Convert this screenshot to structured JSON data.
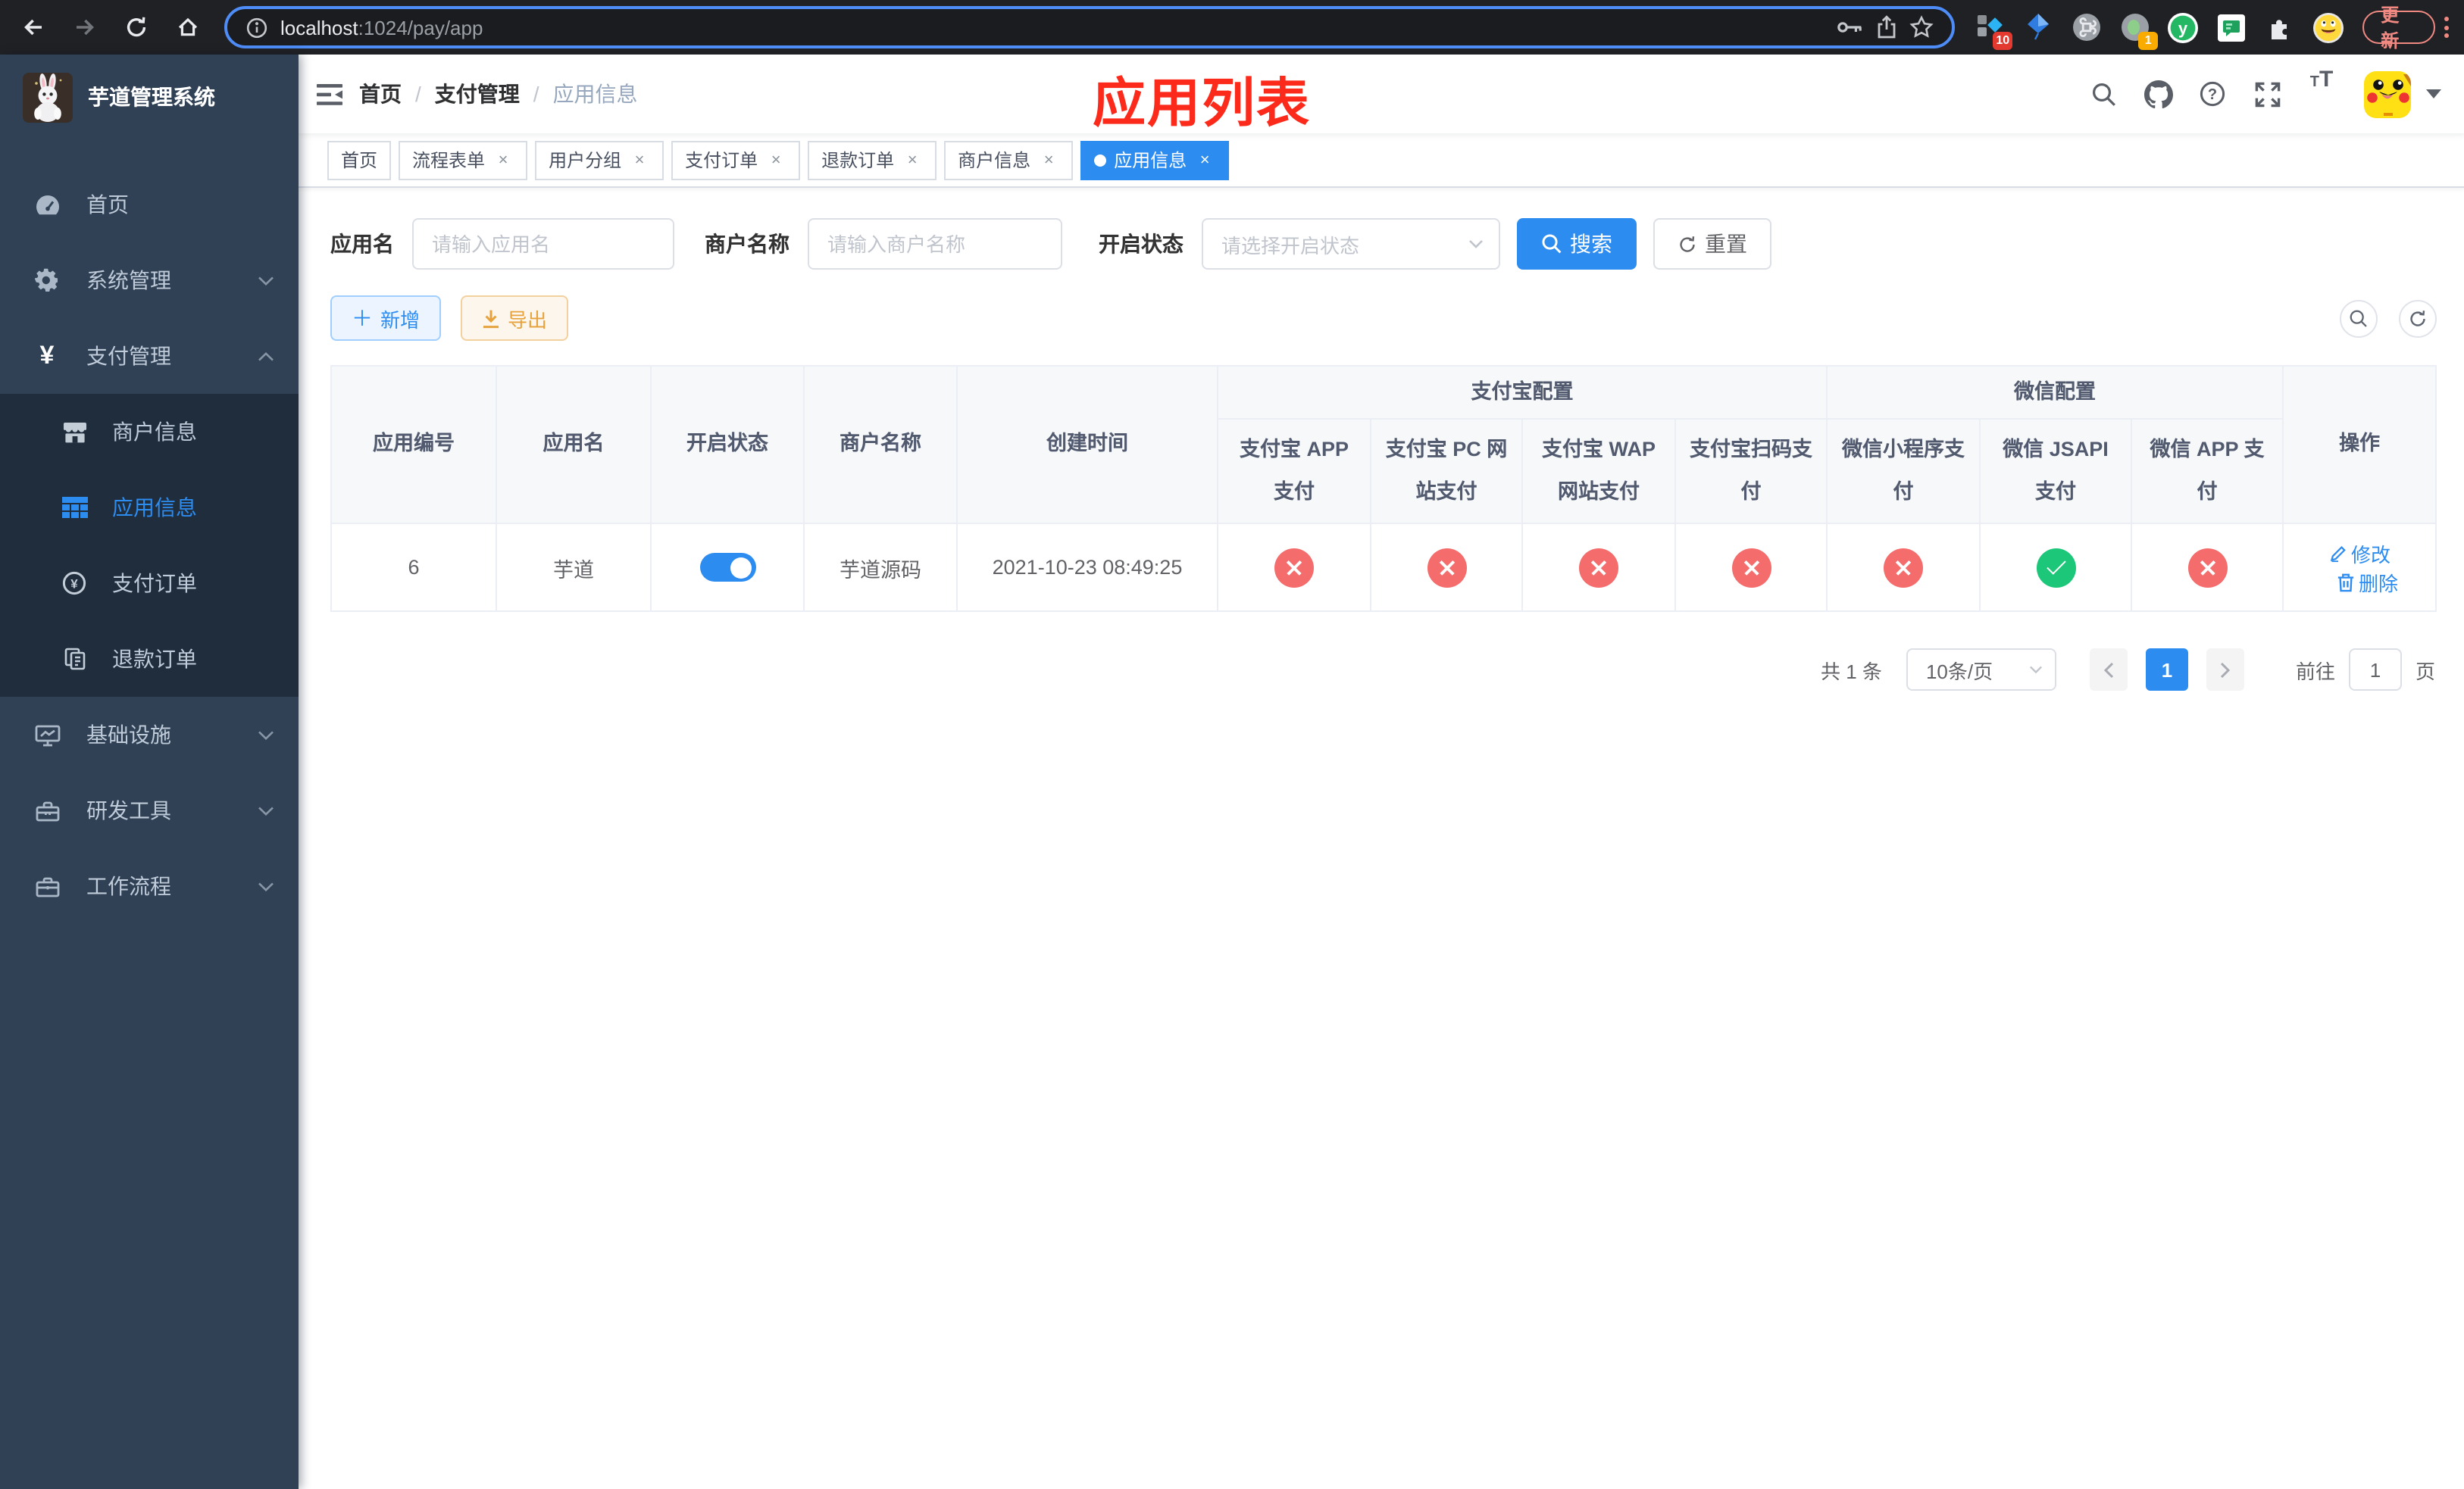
{
  "browser": {
    "url_host": "localhost",
    "url_path": ":1024/pay/app",
    "update_label": "更新",
    "ext_badge_count": "10",
    "tab_badge_count": "1"
  },
  "sidebar": {
    "title": "芋道管理系统",
    "menu": [
      {
        "label": "首页"
      },
      {
        "label": "系统管理"
      },
      {
        "label": "支付管理"
      },
      {
        "label": "基础设施"
      },
      {
        "label": "研发工具"
      },
      {
        "label": "工作流程"
      }
    ],
    "submenu": [
      {
        "label": "商户信息"
      },
      {
        "label": "应用信息"
      },
      {
        "label": "支付订单"
      },
      {
        "label": "退款订单"
      }
    ]
  },
  "header": {
    "breadcrumb": {
      "home": "首页",
      "section": "支付管理",
      "current": "应用信息"
    },
    "annotation": "应用列表"
  },
  "tabs": [
    {
      "label": "首页"
    },
    {
      "label": "流程表单"
    },
    {
      "label": "用户分组"
    },
    {
      "label": "支付订单"
    },
    {
      "label": "退款订单"
    },
    {
      "label": "商户信息"
    },
    {
      "label": "应用信息"
    }
  ],
  "filters": {
    "app_name_label": "应用名",
    "app_name_placeholder": "请输入应用名",
    "merchant_label": "商户名称",
    "merchant_placeholder": "请输入商户名称",
    "status_label": "开启状态",
    "status_placeholder": "请选择开启状态",
    "search_label": "搜索",
    "reset_label": "重置"
  },
  "toolbar": {
    "add_label": "新增",
    "export_label": "导出"
  },
  "table": {
    "columns": [
      "应用编号",
      "应用名",
      "开启状态",
      "商户名称",
      "创建时间"
    ],
    "groups": {
      "alipay": "支付宝配置",
      "wechat": "微信配置",
      "actions": "操作"
    },
    "subcolumns": [
      "支付宝 APP 支付",
      "支付宝 PC 网站支付",
      "支付宝 WAP 网站支付",
      "支付宝扫码支付",
      "微信小程序支付",
      "微信 JSAPI 支付",
      "微信 APP 支付"
    ],
    "row": {
      "id": "6",
      "name": "芋道",
      "enabled": true,
      "merchant": "芋道源码",
      "created": "2021-10-23 08:49:25",
      "statuses": [
        "fail",
        "fail",
        "fail",
        "fail",
        "fail",
        "success",
        "fail"
      ],
      "edit_label": "修改",
      "delete_label": "删除"
    }
  },
  "pagination": {
    "total": "共 1 条",
    "page_size": "10条/页",
    "page": "1",
    "goto_label": "前往",
    "goto_value": "1",
    "unit_label": "页"
  },
  "colors": {
    "accent": "#2d8cf0",
    "danger": "#f56c6c",
    "success": "#1dc779",
    "warning": "#e6a23c",
    "annotation": "#fb2a1a"
  }
}
